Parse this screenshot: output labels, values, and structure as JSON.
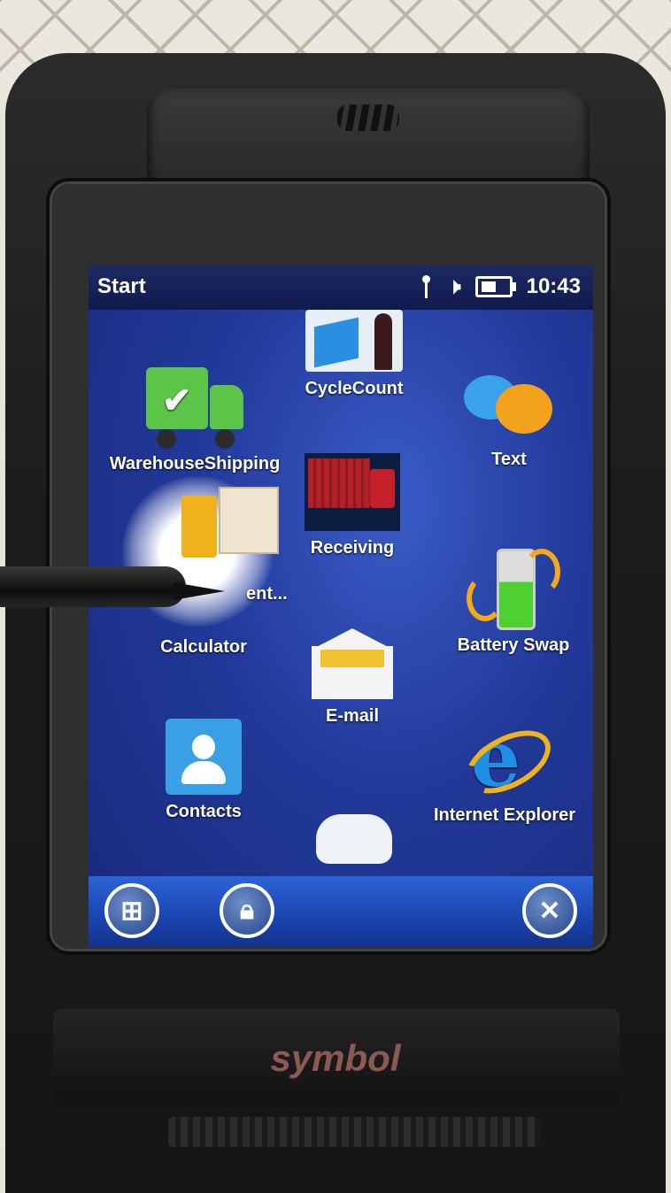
{
  "statusbar": {
    "title": "Start",
    "time": "10:43"
  },
  "apps": {
    "cyclecount": "CycleCount",
    "warehouse_shipping": "WarehouseShipping",
    "text": "Text",
    "receiving": "Receiving",
    "ellipsis_app": "ent...",
    "calculator": "Calculator",
    "battery_swap": "Battery Swap",
    "email": "E-mail",
    "contacts": "Contacts",
    "internet_explorer": "Internet Explorer"
  },
  "taskbar": {
    "start_icon": "windows-logo-icon",
    "lock_icon": "lock-icon",
    "close_icon": "close-icon"
  },
  "device": {
    "brand": "symbol"
  },
  "colors": {
    "screen_bg": "#22399a",
    "taskbar": "#1a44ae",
    "status_bg": "#0f1a4d"
  }
}
